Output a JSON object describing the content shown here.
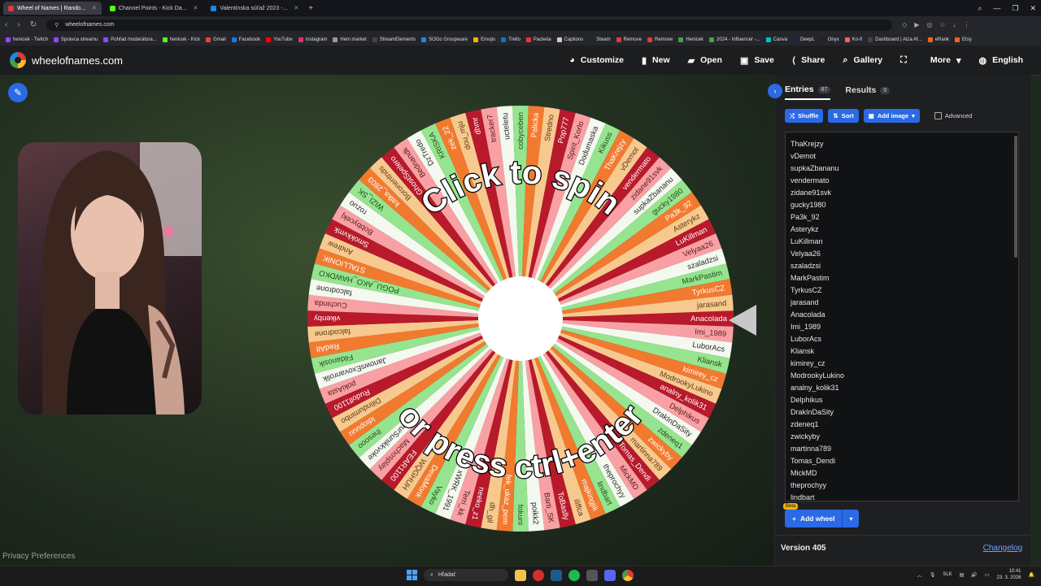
{
  "browser": {
    "tabs": [
      {
        "label": "Wheel of Names | Rando...",
        "active": true,
        "color": "#e53935"
      },
      {
        "label": "Channel Points - Kick Da...",
        "active": false,
        "color": "#53fc18"
      },
      {
        "label": "Valentínska súťaž 2023 -...",
        "active": false,
        "color": "#1e88e5"
      }
    ],
    "url": "wheelofnames.com",
    "bookmarks": [
      "henicek - Twitch",
      "Správca streamu",
      "Pohľad moderátora...",
      "henicek - Kick",
      "Gmail",
      "Facebook",
      "YouTube",
      "Instagram",
      "Heni market",
      "StreamElements",
      "SOGo Groupware",
      "Emojis",
      "Trello",
      "Packeta",
      "Captions",
      "Steam",
      "Remove",
      "Remove",
      "Henicek",
      "2024 - Influencer -...",
      "Canva",
      "DeepL",
      "Onyx",
      "Ko-fi",
      "Dashboard | Alza Af...",
      "eRank",
      "Etsy"
    ]
  },
  "app": {
    "logo": "wheelofnames.com",
    "menu": [
      {
        "icon": "palette-icon",
        "glyph": "◕",
        "label": "Customize"
      },
      {
        "icon": "file-icon",
        "glyph": "▮",
        "label": "New"
      },
      {
        "icon": "folder-icon",
        "glyph": "▰",
        "label": "Open"
      },
      {
        "icon": "save-icon",
        "glyph": "▣",
        "label": "Save"
      },
      {
        "icon": "share-icon",
        "glyph": "⟨",
        "label": "Share"
      },
      {
        "icon": "search-icon",
        "glyph": "⌕",
        "label": "Gallery"
      },
      {
        "icon": "fullscreen-icon",
        "glyph": "⛶",
        "label": ""
      },
      {
        "icon": "chevron-down-icon",
        "glyph": "▾",
        "label": "More"
      },
      {
        "icon": "globe-icon",
        "glyph": "◍",
        "label": "English"
      }
    ]
  },
  "wheel": {
    "text_top": "Click to spin",
    "text_bottom": "or press ctrl+enter",
    "colors": [
      "#b81a2b",
      "#f9a0a4",
      "#f4f9f0",
      "#96e48f",
      "#f17a2f",
      "#f8c98f"
    ],
    "slice_names": [
      "Anacolada",
      "Imi_1989",
      "LuborAcs",
      "Kliansk",
      "kimirey_cz",
      "ModrookyLukino",
      "analny_kolik31",
      "Delphikus",
      "DrakInDaSity",
      "zdeneq1",
      "zwickyby",
      "martinna789",
      "Tomas_Dendi",
      "MickMD",
      "theprochyy",
      "lindbart",
      "majkingjik",
      "iliffca",
      "ToBaslly",
      "Barti_SK",
      "poikk2",
      "fokuni",
      "fek_ukaz_pem",
      "dh_gil",
      "neeko_z1",
      "Terri_kk",
      "xWRK_1991",
      "Vayko",
      "DexaMonk",
      "WQGHUH",
      "FEAR1100",
      "Machosplay",
      "eurSunikkvoke",
      "lhesooo",
      "Idiopuuu",
      "Dilinduminbo",
      "Rudolf1100",
      "pokiAsta",
      "JanowsExovanrolik",
      "Fildanosik",
      "RedAlt",
      "falcodrone",
      "vikenby",
      "Cuchinda",
      "falcodrone",
      "POGU_AKO_HAWDKO",
      "STALLIONIK",
      "Andrew",
      "Smokkvmk",
      "Bobbycekj",
      "rozuo",
      "WIZI_SK",
      "katka_2803",
      "Boronentnds",
      "GhostSpelero",
      "Bednandk",
      "DzTredo",
      "KRISKA",
      "zek_22",
      "dou_mju",
      "dhmr",
      "tracker7",
      "ucteletu",
      "cobyceben",
      "Palicka",
      "Stredno",
      "Pop777",
      "Spirit_Korlo",
      "Dodumaska",
      "Kikuss",
      "ThaKrejzy",
      "vDemot",
      "vendermato",
      "zidane91svk",
      "supkaZbananu",
      "gucky1980",
      "Pa3k_92",
      "Asterykz",
      "LuKillman",
      "Velyaa26",
      "szaladzsi",
      "MarkPastim",
      "TyrkusCZ",
      "jarasand"
    ]
  },
  "panel": {
    "tabs": [
      {
        "label": "Entries",
        "count": "87",
        "active": true
      },
      {
        "label": "Results",
        "count": "0",
        "active": false
      }
    ],
    "toolbar": {
      "shuffle": "Shuffle",
      "sort": "Sort",
      "add_image": "Add image",
      "advanced": "Advanced"
    },
    "entries": [
      "ThaKrejzy",
      "vDemot",
      "supkaZbananu",
      "vendermato",
      "zidane91svk",
      "gucky1980",
      "Pa3k_92",
      "Asterykz",
      "LuKillman",
      "Velyaa26",
      "szaladzsi",
      "MarkPastim",
      "TyrkusCZ",
      "jarasand",
      "Anacolada",
      "Imi_1989",
      "LuborAcs",
      "Kliansk",
      "kimirey_cz",
      "ModrookyLukino",
      "analny_kolik31",
      "Delphikus",
      "DrakInDaSity",
      "zdeneq1",
      "zwickyby",
      "martinna789",
      "Tomas_Dendi",
      "MickMD",
      "theprochyy",
      "lindbart"
    ],
    "add_wheel": "Add wheel",
    "beta": "Beta",
    "version": "Version 405",
    "changelog": "Changelog"
  },
  "footer": {
    "privacy": "Privacy Preferences"
  },
  "taskbar": {
    "search": "Hľadať",
    "lang": "SLK",
    "time": "10:41",
    "date": "23. 3. 2026"
  }
}
